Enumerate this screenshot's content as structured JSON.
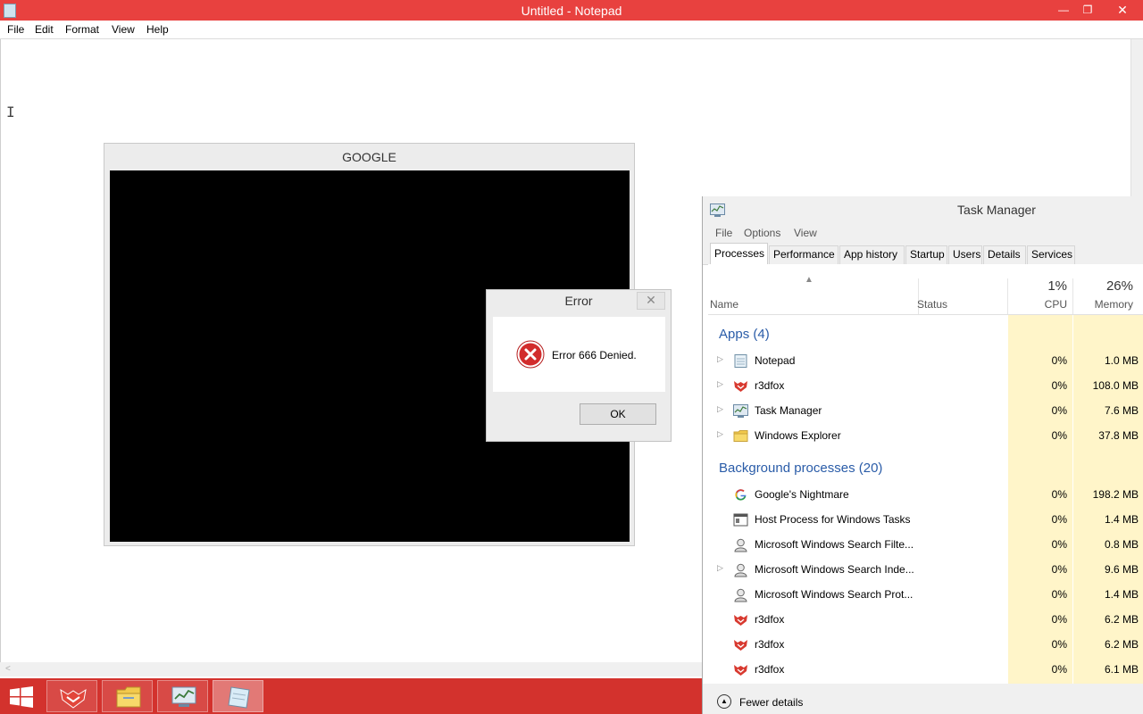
{
  "notepad": {
    "title": "Untitled - Notepad",
    "controls": {
      "minimize": "—",
      "restore": "❐",
      "close": "✕"
    },
    "menu": [
      "File",
      "Edit",
      "Format",
      "View",
      "Help"
    ]
  },
  "google_window": {
    "title": "GOOGLE"
  },
  "error_dialog": {
    "title": "Error",
    "close": "✕",
    "message": "Error 666 Denied.",
    "ok": "OK",
    "icon": "error-x-icon"
  },
  "task_manager": {
    "title": "Task Manager",
    "menu": [
      "File",
      "Options",
      "View"
    ],
    "tabs": [
      "Processes",
      "Performance",
      "App history",
      "Startup",
      "Users",
      "Details",
      "Services"
    ],
    "active_tab": "Processes",
    "columns": {
      "name": "Name",
      "status": "Status",
      "cpu_pct": "1%",
      "cpu": "CPU",
      "mem_pct": "26%",
      "memory": "Memory"
    },
    "apps_header": "Apps (4)",
    "apps": [
      {
        "name": "Notepad",
        "cpu": "0%",
        "memory": "1.0 MB",
        "icon": "notepad-icon",
        "expandable": true
      },
      {
        "name": "r3dfox",
        "cpu": "0%",
        "memory": "108.0 MB",
        "icon": "r3dfox-icon",
        "expandable": true
      },
      {
        "name": "Task Manager",
        "cpu": "0%",
        "memory": "7.6 MB",
        "icon": "task-manager-icon",
        "expandable": true
      },
      {
        "name": "Windows Explorer",
        "cpu": "0%",
        "memory": "37.8 MB",
        "icon": "folder-icon",
        "expandable": true
      }
    ],
    "bg_header": "Background processes (20)",
    "background": [
      {
        "name": "Google's Nightmare",
        "cpu": "0%",
        "memory": "198.2 MB",
        "icon": "google-icon",
        "expandable": false
      },
      {
        "name": "Host Process for Windows Tasks",
        "cpu": "0%",
        "memory": "1.4 MB",
        "icon": "host-process-icon",
        "expandable": false
      },
      {
        "name": "Microsoft Windows Search Filte...",
        "cpu": "0%",
        "memory": "0.8 MB",
        "icon": "search-user-icon",
        "expandable": false
      },
      {
        "name": "Microsoft Windows Search Inde...",
        "cpu": "0%",
        "memory": "9.6 MB",
        "icon": "search-user-icon",
        "expandable": true
      },
      {
        "name": "Microsoft Windows Search Prot...",
        "cpu": "0%",
        "memory": "1.4 MB",
        "icon": "search-user-icon",
        "expandable": false
      },
      {
        "name": "r3dfox",
        "cpu": "0%",
        "memory": "6.2 MB",
        "icon": "r3dfox-icon",
        "expandable": false
      },
      {
        "name": "r3dfox",
        "cpu": "0%",
        "memory": "6.2 MB",
        "icon": "r3dfox-icon",
        "expandable": false
      },
      {
        "name": "r3dfox",
        "cpu": "0%",
        "memory": "6.1 MB",
        "icon": "r3dfox-icon",
        "expandable": false
      }
    ],
    "footer": "Fewer details"
  },
  "taskbar": {
    "items": [
      "start-icon",
      "r3dfox-icon",
      "file-explorer-icon",
      "task-manager-icon",
      "notepad-icon"
    ],
    "color": "#d3322d"
  },
  "colors": {
    "notepad_title": "#e8413f",
    "group_header": "#2a5ca8",
    "heat": "#fff5c9"
  }
}
